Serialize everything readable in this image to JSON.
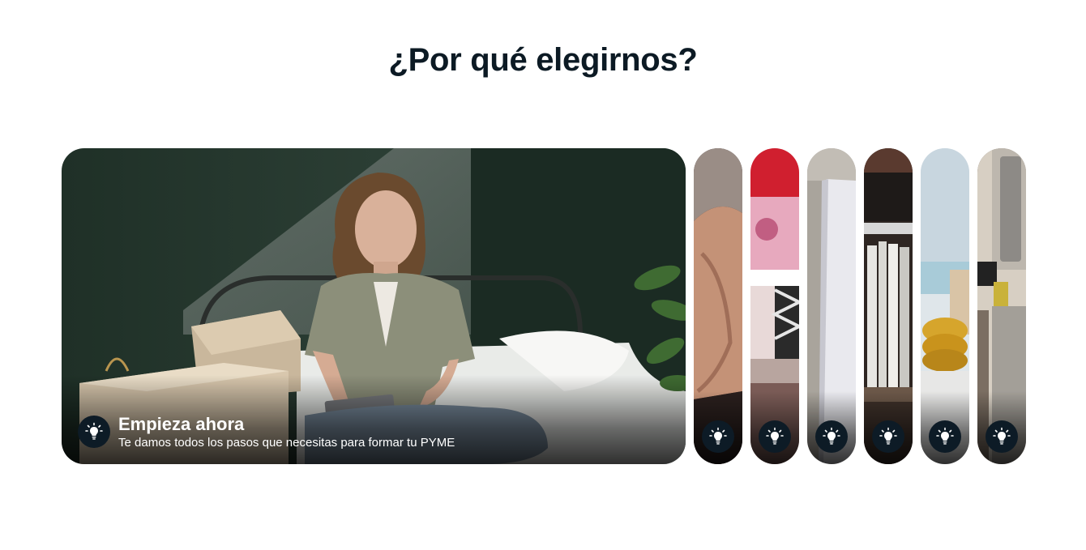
{
  "section": {
    "title": "¿Por qué elegirnos?"
  },
  "cards": [
    {
      "title": "Empieza ahora",
      "description": "Te damos todos los pasos que necesitas para formar tu PYME",
      "icon": "lightbulb-icon",
      "expanded": true
    },
    {
      "icon": "lightbulb-icon",
      "expanded": false
    },
    {
      "icon": "lightbulb-icon",
      "expanded": false
    },
    {
      "icon": "lightbulb-icon",
      "expanded": false
    },
    {
      "icon": "lightbulb-icon",
      "expanded": false
    },
    {
      "icon": "lightbulb-icon",
      "expanded": false
    },
    {
      "icon": "lightbulb-icon",
      "expanded": false
    }
  ],
  "colors": {
    "title": "#0c1a24",
    "badge": "#0d1b26",
    "card_text": "#ffffff"
  }
}
